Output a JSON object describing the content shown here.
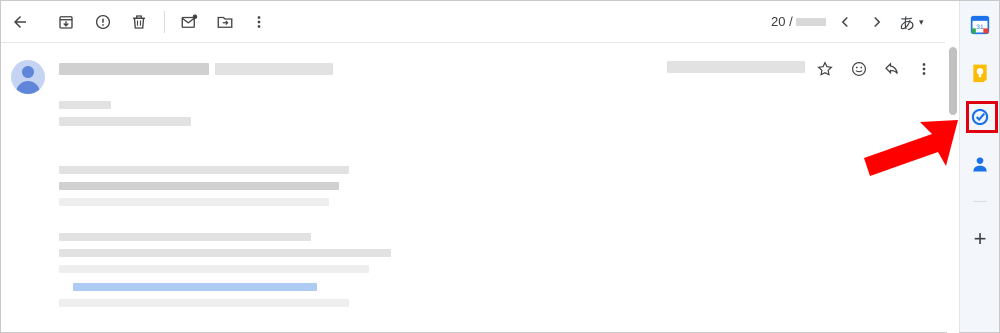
{
  "toolbar": {
    "icons": [
      "back-icon",
      "archive-icon",
      "report-spam-icon",
      "delete-icon",
      "mark-unread-icon",
      "move-to-icon",
      "more-vert-icon"
    ],
    "pager_text": "20 /",
    "prev_icon": "chevron-left-icon",
    "next_icon": "chevron-right-icon",
    "input_tool_label": "あ",
    "input_tool_caret": "▾"
  },
  "message": {
    "actions": [
      "star-icon",
      "emoji-icon",
      "reply-icon",
      "more-vert-icon"
    ]
  },
  "side_panel": {
    "apps": [
      {
        "name": "calendar",
        "label": "31",
        "color": "#1a73e8"
      },
      {
        "name": "keep",
        "color": "#fbbc04"
      },
      {
        "name": "tasks",
        "color": "#1a73e8"
      },
      {
        "name": "contacts",
        "color": "#1a73e8"
      }
    ],
    "add_label": "+"
  },
  "annotation": {
    "highlight_color": "#e1000f",
    "arrow_color": "#ff0000"
  }
}
